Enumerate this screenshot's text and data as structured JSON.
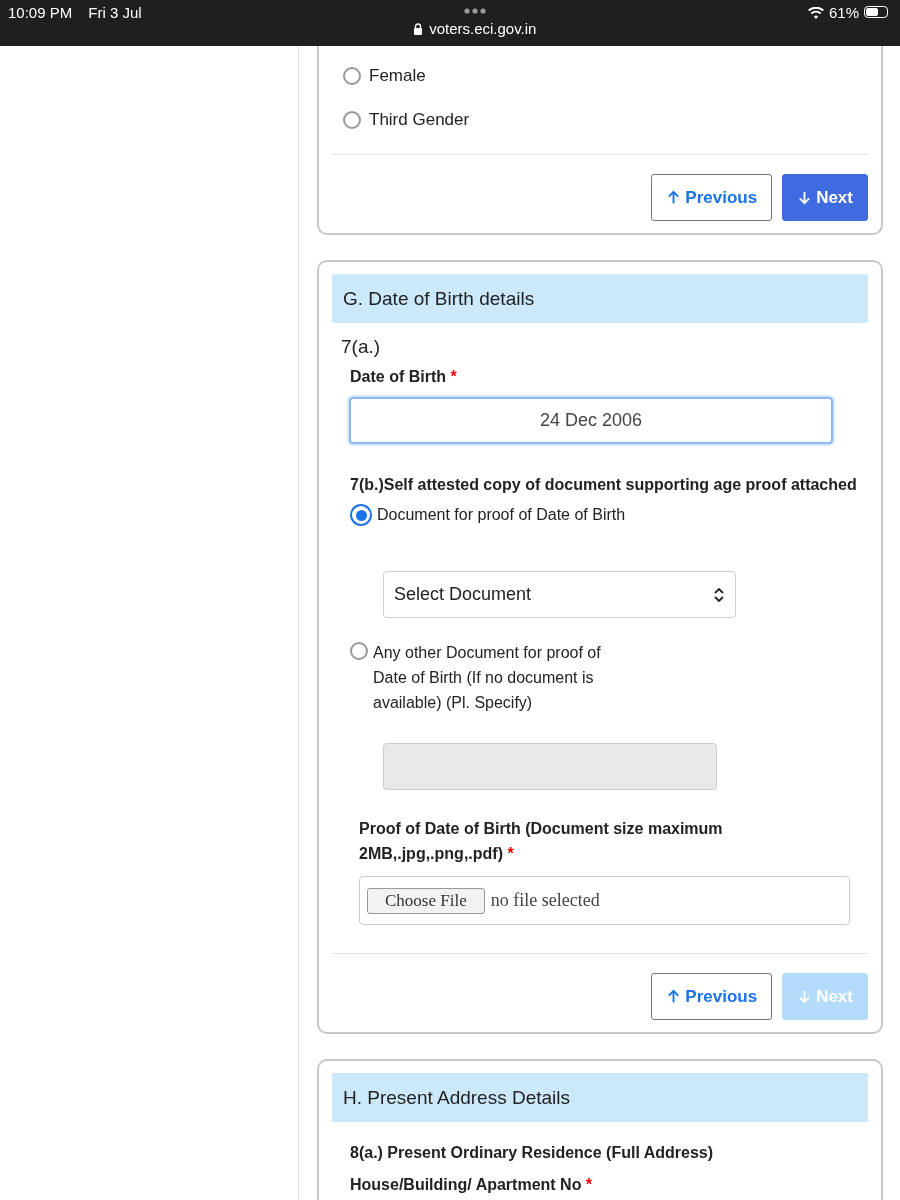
{
  "status_bar": {
    "time": "10:09 PM",
    "date": "Fri 3 Jul",
    "url": "voters.eci.gov.in",
    "battery": "61%",
    "level": 0.61
  },
  "gender_section": {
    "options": [
      {
        "label": "Female",
        "selected": false
      },
      {
        "label": "Third Gender",
        "selected": false
      }
    ],
    "buttons": [
      {
        "kind": "previous",
        "label": "Previous",
        "disabled": false
      },
      {
        "kind": "next",
        "label": "Next",
        "disabled": false
      }
    ]
  },
  "dob_section": {
    "heading": "G. Date of Birth details",
    "question": "7(a.)",
    "dob_label": "Date of Birth",
    "required_mark": "*",
    "dob_value": "24 Dec 2006",
    "proof_question": "7(b.)Self attested copy of document supporting age proof attached",
    "proof_options": [
      {
        "label": "Document for proof of Date of Birth",
        "selected": true,
        "kind": "select",
        "value": "Select Document"
      },
      {
        "label": "Any other Document for proof of Date of Birth (If no document is available) (Pl. Specify)",
        "selected": false,
        "kind": "text",
        "disabled": true
      }
    ],
    "upload_label": "Proof of Date of Birth (Document size maximum 2MB,.jpg,.png,.pdf)",
    "upload_required_mark": "*",
    "upload_button": "Choose File",
    "upload_status": "no file selected",
    "buttons": [
      {
        "kind": "previous",
        "label": "Previous",
        "disabled": false
      },
      {
        "kind": "next",
        "label": "Next",
        "disabled": true
      }
    ]
  },
  "address_section": {
    "heading": "H. Present Address Details",
    "question": "8(a.) Present Ordinary Residence (Full Address)",
    "field_label": "House/Building/ Apartment No",
    "required_mark": "*"
  }
}
